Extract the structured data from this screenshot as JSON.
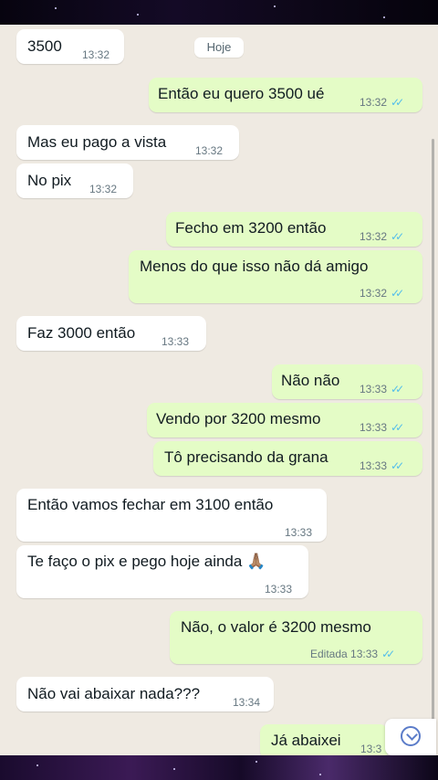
{
  "date_chip": "Hoje",
  "messages": [
    {
      "dir": "in",
      "text": "3500",
      "time": "13:32"
    },
    {
      "dir": "out",
      "text": "Então eu quero 3500 ué",
      "time": "13:32"
    },
    {
      "dir": "in",
      "text": "Mas eu pago a vista",
      "time": "13:32"
    },
    {
      "dir": "in",
      "text": "No pix",
      "time": "13:32"
    },
    {
      "dir": "out",
      "text": "Fecho em 3200 então",
      "time": "13:32"
    },
    {
      "dir": "out",
      "text": "Menos do que isso não dá amigo",
      "time": "13:32"
    },
    {
      "dir": "in",
      "text": "Faz 3000 então",
      "time": "13:33"
    },
    {
      "dir": "out",
      "text": "Não não",
      "time": "13:33"
    },
    {
      "dir": "out",
      "text": "Vendo por 3200 mesmo",
      "time": "13:33"
    },
    {
      "dir": "out",
      "text": "Tô precisando da grana",
      "time": "13:33"
    },
    {
      "dir": "in",
      "text": "Então vamos fechar em 3100 então",
      "time": "13:33"
    },
    {
      "dir": "in",
      "text": "Te faço o pix e pego hoje ainda 🙏🏽",
      "time": "13:33"
    },
    {
      "dir": "out",
      "text": "Não, o valor é 3200 mesmo",
      "time": "13:33",
      "edited": "Editada"
    },
    {
      "dir": "in",
      "text": "Não vai abaixar nada???",
      "time": "13:34"
    },
    {
      "dir": "out",
      "text": "Já abaixei",
      "time": "13:3"
    }
  ],
  "ticks": "✓✓",
  "colors": {
    "incoming": "#ffffff",
    "outgoing": "#e4fcc6",
    "background": "#efeae2",
    "read_ticks": "#53bdeb"
  },
  "icons": {
    "scroll_down": "chevron-down-icon"
  }
}
